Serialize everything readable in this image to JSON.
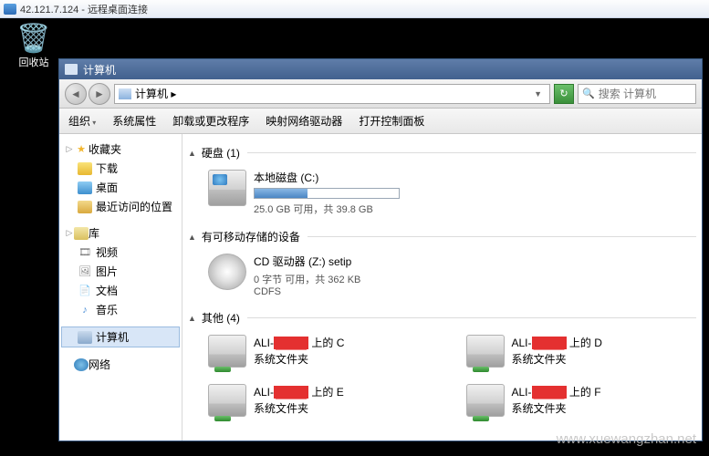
{
  "rdp": {
    "title": "42.121.7.124 - 远程桌面连接"
  },
  "desktop": {
    "recycle": "回收站"
  },
  "window": {
    "title": "计算机"
  },
  "address": {
    "text": "计算机 ▸"
  },
  "search": {
    "placeholder": "搜索 计算机"
  },
  "toolbar": {
    "organize": "组织",
    "sys_props": "系统属性",
    "uninstall": "卸载或更改程序",
    "map_drive": "映射网络驱动器",
    "control_panel": "打开控制面板"
  },
  "sidebar": {
    "favorites": "收藏夹",
    "downloads": "下载",
    "desktop": "桌面",
    "recent": "最近访问的位置",
    "libraries": "库",
    "videos": "视频",
    "pictures": "图片",
    "documents": "文档",
    "music": "音乐",
    "computer": "计算机",
    "network": "网络"
  },
  "content": {
    "section_hdd": "硬盘 (1)",
    "hdd": {
      "name": "本地磁盘 (C:)",
      "stat": "25.0 GB 可用，共 39.8 GB",
      "used_pct": 37
    },
    "section_removable": "有可移动存储的设备",
    "cd": {
      "name": "CD 驱动器 (Z:) setip",
      "stat": "0 字节 可用，共 362 KB",
      "fs": "CDFS"
    },
    "section_other": "其他 (4)",
    "net_prefix": "ALI-",
    "net_suffix_c": " 上的 C",
    "net_suffix_d": " 上的 D",
    "net_suffix_e": " 上的 E",
    "net_suffix_f": " 上的 F",
    "sys_folder": "系统文件夹",
    "redact": "████"
  },
  "watermark": "www.xuewangzhan.net"
}
